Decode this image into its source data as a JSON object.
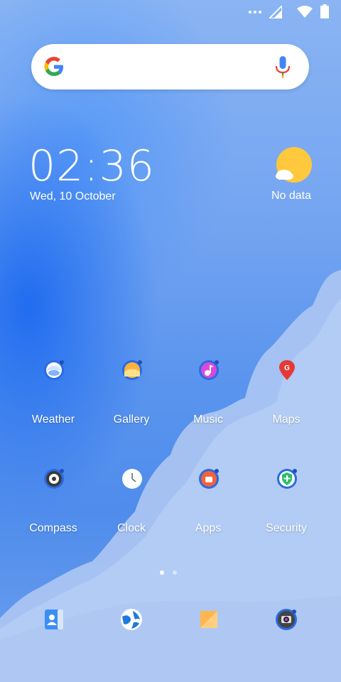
{
  "status_bar": {
    "icons": [
      "more-dots-icon",
      "cell-signal-icon",
      "wifi-icon",
      "battery-icon"
    ]
  },
  "search_bar": {
    "icons": [
      "google-g-icon",
      "microphone-icon"
    ]
  },
  "clock_widget": {
    "time": "02:36",
    "date": "Wed, 10 October"
  },
  "weather_widget": {
    "status": "No data",
    "icon": "sun-cloud-icon"
  },
  "apps": [
    {
      "label": "Weather",
      "icon": "weather-icon"
    },
    {
      "label": "Gallery",
      "icon": "gallery-icon"
    },
    {
      "label": "Music",
      "icon": "music-icon"
    },
    {
      "label": "Maps",
      "icon": "maps-pin-icon"
    },
    {
      "label": "Compass",
      "icon": "compass-icon"
    },
    {
      "label": "Clock",
      "icon": "clock-icon"
    },
    {
      "label": "Apps",
      "icon": "apps-store-icon"
    },
    {
      "label": "Security",
      "icon": "security-shield-icon"
    }
  ],
  "page_indicator": {
    "pages": 2,
    "active": 1
  },
  "dock": [
    {
      "icon": "contacts-icon"
    },
    {
      "icon": "browser-globe-icon"
    },
    {
      "icon": "notes-icon"
    },
    {
      "icon": "camera-icon"
    }
  ],
  "colors": {
    "accent_blue": "#2b6be0",
    "weather_sun": "#ffc83d",
    "maps_red": "#e53935",
    "security_green": "#2ebd6b",
    "notes_orange": "#ffb74d"
  }
}
